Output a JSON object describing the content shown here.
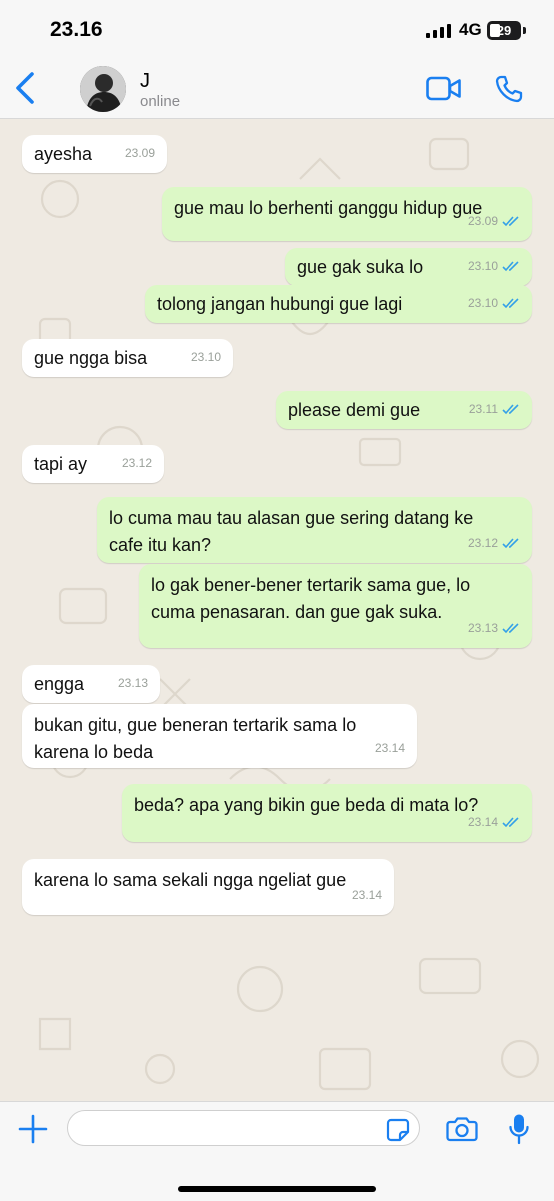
{
  "status_bar": {
    "time": "23.16",
    "network": "4G",
    "battery": "29"
  },
  "header": {
    "contact_name": "J",
    "presence": "online"
  },
  "messages": [
    {
      "direction": "in",
      "text": "ayesha",
      "time": "23.09"
    },
    {
      "direction": "out",
      "text": "gue mau lo berhenti ganggu hidup gue",
      "time": "23.09"
    },
    {
      "direction": "out",
      "text": "gue gak suka lo",
      "time": "23.10"
    },
    {
      "direction": "out",
      "text": "tolong jangan hubungi gue lagi",
      "time": "23.10"
    },
    {
      "direction": "in",
      "text": "gue ngga bisa",
      "time": "23.10"
    },
    {
      "direction": "out",
      "text": "please demi gue",
      "time": "23.11"
    },
    {
      "direction": "in",
      "text": "tapi ay",
      "time": "23.12"
    },
    {
      "direction": "out",
      "text": "lo cuma mau tau alasan gue sering datang ke\ncafe itu kan?",
      "time": "23.12"
    },
    {
      "direction": "out",
      "text": "lo gak bener-bener tertarik sama gue, lo\ncuma penasaran. dan gue gak suka.",
      "time": "23.13"
    },
    {
      "direction": "in",
      "text": "engga",
      "time": "23.13"
    },
    {
      "direction": "in",
      "text": "bukan gitu, gue beneran tertarik sama lo\nkarena lo beda",
      "time": "23.14"
    },
    {
      "direction": "out",
      "text": "beda? apa yang bikin gue beda di mata lo?",
      "time": "23.14"
    },
    {
      "direction": "in",
      "text": "karena lo sama sekali ngga ngeliat gue",
      "time": "23.14"
    }
  ],
  "composer": {
    "value": "",
    "placeholder": ""
  },
  "colors": {
    "accent": "#1a7ff0",
    "incoming_bubble": "#ffffff",
    "outgoing_bubble": "#dcf8c6",
    "chat_background": "#efeae2",
    "read_ticks": "#34a0e8"
  },
  "icons": [
    "back-chevron-icon",
    "video-call-icon",
    "phone-icon",
    "plus-icon",
    "sticker-icon",
    "camera-icon",
    "microphone-icon",
    "read-receipt-icon"
  ]
}
